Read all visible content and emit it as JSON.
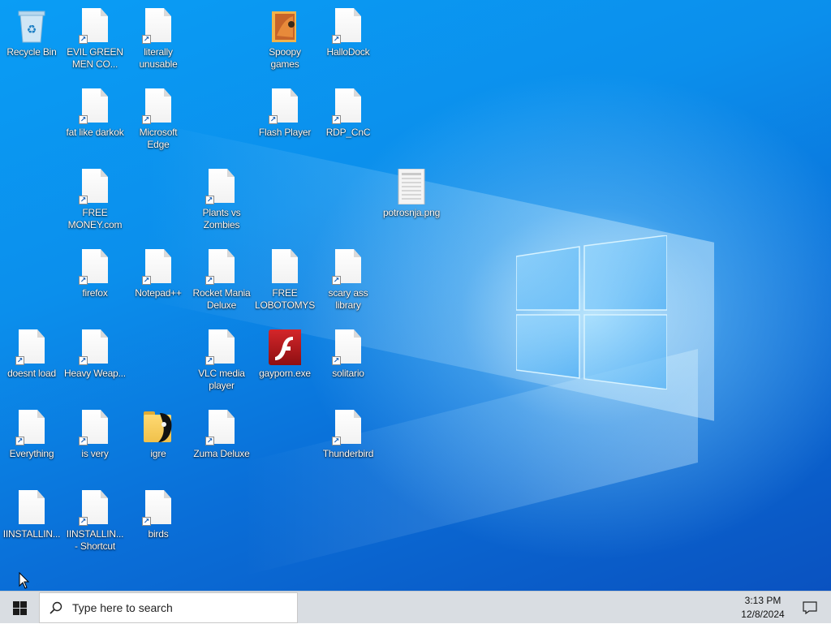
{
  "desktop": {
    "icons": [
      {
        "id": "recycle-bin",
        "label": "Recycle Bin",
        "type": "recycle"
      },
      {
        "id": "evil-green",
        "label": "EVIL GREEN MEN CO...",
        "type": "shortcut"
      },
      {
        "id": "literally-unusable",
        "label": "literally unusable",
        "type": "shortcut"
      },
      {
        "id": "spoopy-games",
        "label": "Spoopy games",
        "type": "folder-art"
      },
      {
        "id": "hallodock",
        "label": "HalloDock",
        "type": "shortcut"
      },
      {
        "id": "fat-like-darkok",
        "label": "fat like darkok",
        "type": "shortcut"
      },
      {
        "id": "microsoft-edge",
        "label": "Microsoft Edge",
        "type": "shortcut"
      },
      {
        "id": "flash-player",
        "label": "Flash Player",
        "type": "shortcut"
      },
      {
        "id": "rdp-cnc",
        "label": "RDP_CnC",
        "type": "shortcut"
      },
      {
        "id": "free-money",
        "label": "FREE MONEY.com",
        "type": "shortcut"
      },
      {
        "id": "plants-vs-zombies",
        "label": "Plants vs Zombies",
        "type": "shortcut"
      },
      {
        "id": "potrosnja",
        "label": "potrosnja.png",
        "type": "image"
      },
      {
        "id": "firefox",
        "label": "firefox",
        "type": "shortcut"
      },
      {
        "id": "notepad-pp",
        "label": "Notepad++",
        "type": "shortcut"
      },
      {
        "id": "rocket-mania",
        "label": "Rocket Mania Deluxe",
        "type": "shortcut"
      },
      {
        "id": "free-lobotomys",
        "label": "FREE LOBOTOMYS",
        "type": "file"
      },
      {
        "id": "scary-ass-library",
        "label": "scary ass library",
        "type": "shortcut"
      },
      {
        "id": "doesnt-load",
        "label": "doesnt load",
        "type": "shortcut"
      },
      {
        "id": "heavy-weap",
        "label": "Heavy Weap...",
        "type": "shortcut"
      },
      {
        "id": "vlc",
        "label": "VLC media player",
        "type": "shortcut"
      },
      {
        "id": "gayporn-exe",
        "label": "gayporn.exe",
        "type": "flash"
      },
      {
        "id": "solitario",
        "label": "solitario",
        "type": "shortcut"
      },
      {
        "id": "everything",
        "label": "Everything",
        "type": "shortcut"
      },
      {
        "id": "is-very",
        "label": "is very",
        "type": "shortcut"
      },
      {
        "id": "igre",
        "label": "igre",
        "type": "folder-dark"
      },
      {
        "id": "zuma-deluxe",
        "label": "Zuma Deluxe",
        "type": "shortcut"
      },
      {
        "id": "thunderbird",
        "label": "Thunderbird",
        "type": "shortcut"
      },
      {
        "id": "installin-1",
        "label": "IINSTALLIN...",
        "type": "file"
      },
      {
        "id": "installin-shortcut",
        "label": "IINSTALLIN... - Shortcut",
        "type": "shortcut"
      },
      {
        "id": "birds",
        "label": "birds",
        "type": "shortcut"
      }
    ]
  },
  "taskbar": {
    "search_placeholder": "Type here to search",
    "time": "3:13 PM",
    "date": "12/8/2024"
  }
}
